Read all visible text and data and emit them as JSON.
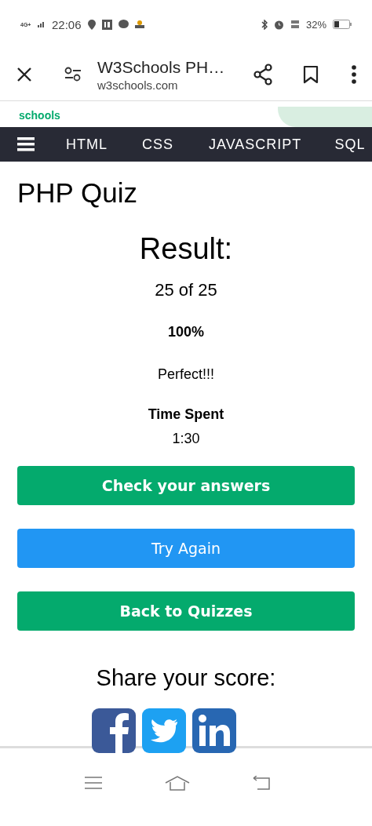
{
  "status_bar": {
    "network": "4G+",
    "time": "22:06",
    "battery": "32%"
  },
  "browser": {
    "title": "W3Schools PH…",
    "url": "w3schools.com"
  },
  "site_header": {
    "logo_text": "schools"
  },
  "topnav": {
    "items": [
      {
        "label": "HTML"
      },
      {
        "label": "CSS"
      },
      {
        "label": "JAVASCRIPT"
      },
      {
        "label": "SQL"
      }
    ]
  },
  "page": {
    "title": "PHP Quiz"
  },
  "result": {
    "heading": "Result:",
    "score": "25 of 25",
    "percent": "100%",
    "verdict": "Perfect!!!",
    "time_label": "Time Spent",
    "time": "1:30"
  },
  "buttons": [
    {
      "label": "Check your answers",
      "color": "#04aa6d"
    },
    {
      "label": "Try Again",
      "color": "#2196f3"
    },
    {
      "label": "Back to Quizzes",
      "color": "#04aa6d"
    }
  ],
  "share": {
    "heading": "Share your score:"
  }
}
